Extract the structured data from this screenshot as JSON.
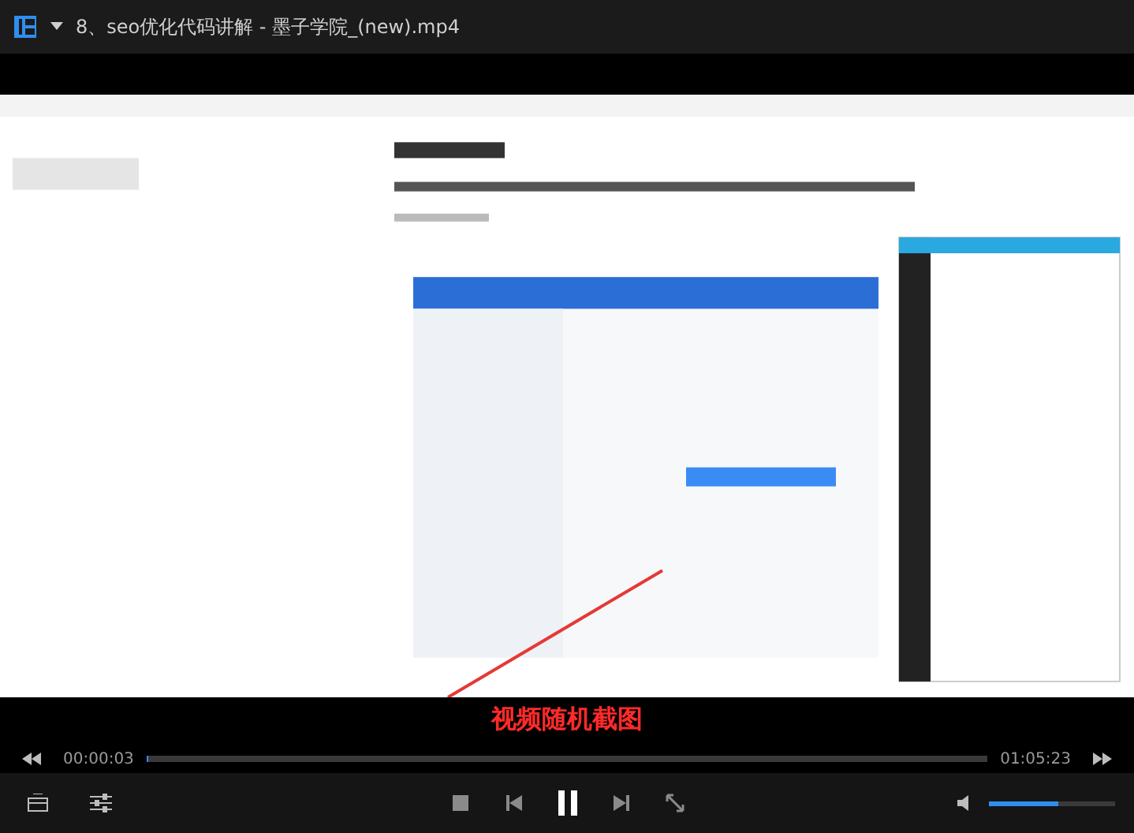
{
  "window": {
    "title": "8、seo优化代码讲解 - 墨子学院_(new).mp4"
  },
  "video": {
    "kind": "picture",
    "subtitle": "视频随机截图"
  },
  "seek": {
    "elapsed": "00:00:03",
    "total": "01:05:23",
    "level": 0.001
  },
  "controls": {
    "playing": true,
    "volume": {
      "level": 0.55
    }
  }
}
